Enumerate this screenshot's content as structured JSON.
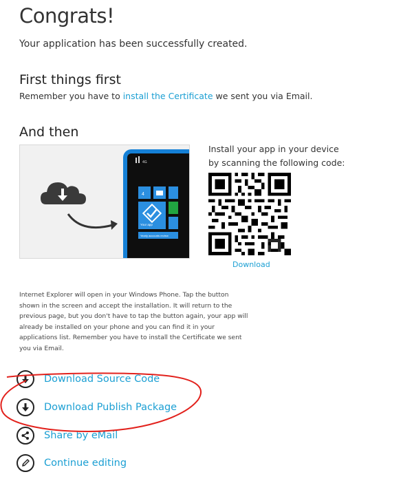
{
  "page": {
    "title": "Congrats!",
    "subtitle": "Your application has been successfully created."
  },
  "first": {
    "heading": "First things first",
    "text_before": "Remember you have to ",
    "link": "install the Certificate",
    "text_after": " we sent you via Email."
  },
  "then": {
    "heading": "And then",
    "scan_line1": "Install your app in your device",
    "scan_line2": "by scanning the following code:",
    "download_link": "Download",
    "instructions": "Internet Explorer will open in your Windows Phone. Tap the button shown in the screen and accept the installation. It will return to the previous page, but you don't have to tap the button again, your app will already be installed on your phone and you can find it in your applications list. Remember you have to install the Certificate we sent you via Email.",
    "phone": {
      "network": "4G",
      "tile_count": "4",
      "app_tile_label": "Your app",
      "bottom_label": "Yearly accounts review"
    }
  },
  "actions": [
    {
      "label": "Download Source Code",
      "icon": "download-icon"
    },
    {
      "label": "Download Publish Package",
      "icon": "download-icon"
    },
    {
      "label": "Share by eMail",
      "icon": "share-icon"
    },
    {
      "label": "Continue editing",
      "icon": "pencil-icon"
    }
  ],
  "colors": {
    "link": "#1b9fd3",
    "annotation": "#e2211c",
    "tile": "#2b8fe0"
  }
}
